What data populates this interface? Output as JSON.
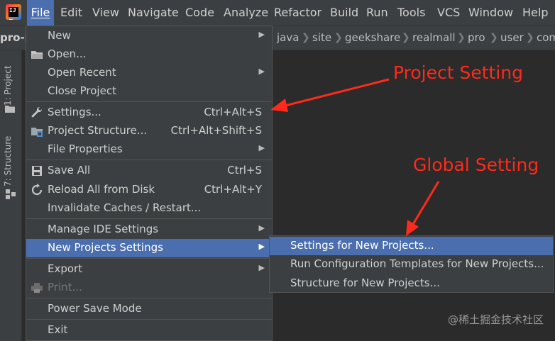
{
  "menubar": {
    "items": [
      "File",
      "Edit",
      "View",
      "Navigate",
      "Code",
      "Analyze",
      "Refactor",
      "Build",
      "Run",
      "Tools",
      "VCS",
      "Window",
      "Help"
    ],
    "mnemonics": [
      "F",
      "E",
      "V",
      "N",
      "C",
      "z",
      "R",
      "B",
      "u",
      "T",
      "S",
      "W",
      "H"
    ],
    "active": "File"
  },
  "navbar": {
    "project": "pro-m",
    "crumbs": [
      "java",
      "site",
      "geekshare",
      "realmall",
      "pro",
      "user",
      "com"
    ]
  },
  "toolwindows": {
    "project_tab": "1: Project",
    "structure_tab": "7: Structure"
  },
  "file_menu": {
    "new": "New",
    "open": "Open...",
    "open_recent": "Open Recent",
    "close_project": "Close Project",
    "settings": "Settings...",
    "settings_shortcut": "Ctrl+Alt+S",
    "project_structure": "Project Structure...",
    "project_structure_shortcut": "Ctrl+Alt+Shift+S",
    "file_properties": "File Properties",
    "save_all": "Save All",
    "save_all_shortcut": "Ctrl+S",
    "reload": "Reload All from Disk",
    "reload_shortcut": "Ctrl+Alt+Y",
    "invalidate": "Invalidate Caches / Restart...",
    "manage_ide": "Manage IDE Settings",
    "new_projects_settings": "New Projects Settings",
    "export": "Export",
    "print": "Print...",
    "power_save": "Power Save Mode",
    "exit": "Exit"
  },
  "submenu": {
    "settings_new": "Settings for New Projects...",
    "run_templates": "Run Configuration Templates for New Projects...",
    "structure_new": "Structure for New Projects..."
  },
  "annotations": {
    "project_setting": "Project Setting",
    "global_setting": "Global Setting"
  },
  "watermark": "@稀土掘金技术社区",
  "colors": {
    "menubar_bg": "#3c3f41",
    "highlight": "#4b6eaf",
    "annotation": "#ff2a1a"
  }
}
